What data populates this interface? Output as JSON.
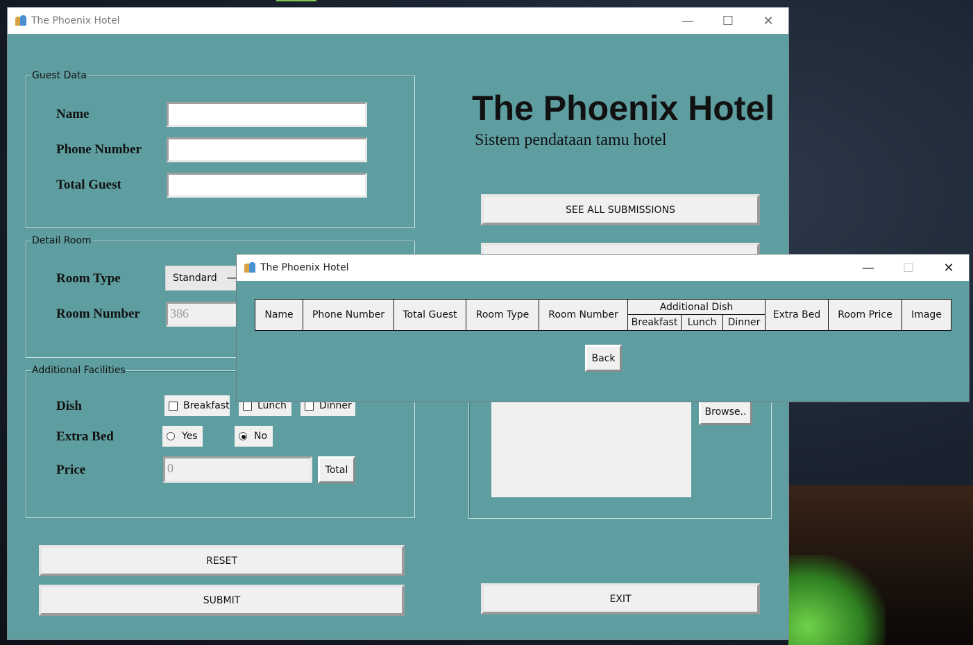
{
  "main_window": {
    "title": "The Phoenix Hotel",
    "guest_data": {
      "legend": "Guest Data",
      "name_label": "Name",
      "name_value": "",
      "phone_label": "Phone Number",
      "phone_value": "",
      "total_guest_label": "Total Guest",
      "total_guest_value": ""
    },
    "detail_room": {
      "legend": "Detail Room",
      "room_type_label": "Room Type",
      "room_type_value": "Standard",
      "room_number_label": "Room Number",
      "room_number_value": "386"
    },
    "additional_facilities": {
      "legend": "Additional Facilities",
      "dish_label": "Dish",
      "breakfast_label": "Breakfast",
      "lunch_label": "Lunch",
      "dinner_label": "Dinner",
      "extra_bed_label": "Extra Bed",
      "yes_label": "Yes",
      "no_label": "No",
      "extra_bed_selected": "No",
      "price_label": "Price",
      "price_value": "0",
      "total_button": "Total"
    },
    "header_title": "The Phoenix Hotel",
    "header_subtitle": "Sistem pendataan tamu hotel",
    "see_all_button": "SEE ALL SUBMISSIONS",
    "browse_button": "Browse..",
    "reset_button": "RESET",
    "submit_button": "SUBMIT",
    "exit_button": "EXIT"
  },
  "popup_window": {
    "title": "The Phoenix Hotel",
    "table_headers": {
      "name": "Name",
      "phone_number": "Phone Number",
      "total_guest": "Total Guest",
      "room_type": "Room Type",
      "room_number": "Room Number",
      "additional_dish": "Additional Dish",
      "breakfast": "Breakfast",
      "lunch": "Lunch",
      "dinner": "Dinner",
      "extra_bed": "Extra Bed",
      "room_price": "Room Price",
      "image": "Image"
    },
    "back_button": "Back"
  },
  "window_controls": {
    "minimize": "—",
    "maximize": "☐",
    "close": "✕"
  },
  "colors": {
    "window_bg": "#5f9ea0",
    "control_bg": "#f0f0f0"
  }
}
